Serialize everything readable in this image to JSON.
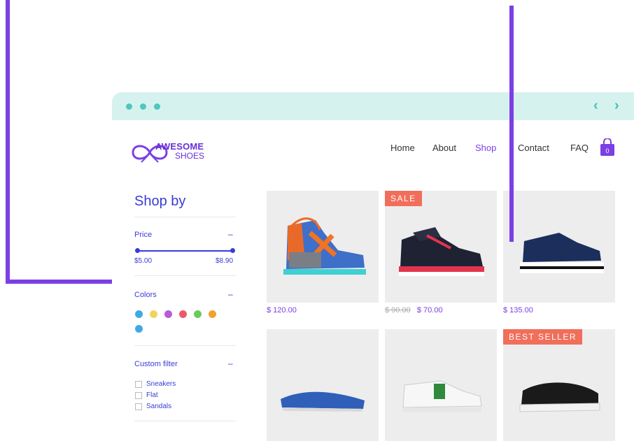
{
  "brand": {
    "line1": "AWESOME",
    "line2": "SHOES"
  },
  "nav": {
    "items": [
      "Home",
      "About",
      "Shop",
      "Contact",
      "FAQ"
    ],
    "active": "Shop",
    "cart_count": "0"
  },
  "sidebar": {
    "title": "Shop by",
    "price": {
      "label": "Price",
      "toggle": "–",
      "min": "$5.00",
      "max": "$8.90"
    },
    "colors": {
      "label": "Colors",
      "toggle": "–",
      "swatches": [
        "#3FA9E6",
        "#F2D35C",
        "#B75BD6",
        "#EC5A6A",
        "#6ACB5B",
        "#F2A12C",
        "#3FA9E6"
      ]
    },
    "custom": {
      "label": "Custom filter",
      "toggle": "–",
      "options": [
        "Sneakers",
        "Flat",
        "Sandals"
      ]
    }
  },
  "products": [
    {
      "price": "$ 120.00",
      "badge": "",
      "old_price": ""
    },
    {
      "price": "$ 70.00",
      "badge": "SALE",
      "old_price": "$ 90.00"
    },
    {
      "price": "$ 135.00",
      "badge": "",
      "old_price": ""
    },
    {
      "price": "",
      "badge": "",
      "old_price": ""
    },
    {
      "price": "",
      "badge": "",
      "old_price": ""
    },
    {
      "price": "",
      "badge": "BEST SELLER",
      "old_price": ""
    }
  ],
  "colors": {
    "accent": "#7B3FE4",
    "sale": "#F16E5A",
    "bar": "#D6F2EE"
  }
}
